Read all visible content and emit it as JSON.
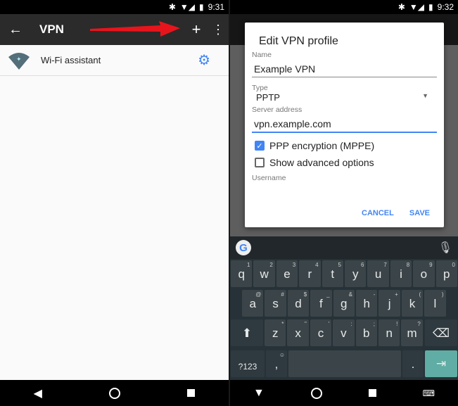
{
  "left": {
    "status_time": "9:31",
    "title": "VPN",
    "add_icon": "+",
    "menu_icon": "⋮",
    "item_label": "Wi-Fi assistant"
  },
  "right": {
    "status_time": "9:32",
    "dialog": {
      "title": "Edit VPN profile",
      "name_label": "Name",
      "name_value": "Example VPN",
      "type_label": "Type",
      "type_value": "PPTP",
      "server_label": "Server address",
      "server_value": "vpn.example.com",
      "ppp_label": "PPP encryption (MPPE)",
      "ppp_checked": true,
      "advanced_label": "Show advanced options",
      "advanced_checked": false,
      "username_label": "Username",
      "cancel": "CANCEL",
      "save": "SAVE"
    },
    "keyboard": {
      "row1": [
        [
          "q",
          "1"
        ],
        [
          "w",
          "2"
        ],
        [
          "e",
          "3"
        ],
        [
          "r",
          "4"
        ],
        [
          "t",
          "5"
        ],
        [
          "y",
          "6"
        ],
        [
          "u",
          "7"
        ],
        [
          "i",
          "8"
        ],
        [
          "o",
          "9"
        ],
        [
          "p",
          "0"
        ]
      ],
      "row2": [
        [
          "a",
          "@"
        ],
        [
          "s",
          "#"
        ],
        [
          "d",
          "$"
        ],
        [
          "f",
          "_"
        ],
        [
          "g",
          "&"
        ],
        [
          "h",
          "-"
        ],
        [
          "j",
          "+"
        ],
        [
          "k",
          "("
        ],
        [
          "l",
          ")"
        ]
      ],
      "row3": [
        [
          "z",
          "*"
        ],
        [
          "x",
          "\""
        ],
        [
          "c",
          "'"
        ],
        [
          "v",
          ":"
        ],
        [
          "b",
          ";"
        ],
        [
          "n",
          "!"
        ],
        [
          "m",
          "?"
        ]
      ],
      "symbols": "?123",
      "comma": ",",
      "period": ".",
      "enter_color": "#5fada4"
    }
  },
  "colors": {
    "accent": "#4285f4",
    "toolbar": "#2b2b2b",
    "arrow": "#e8141c"
  }
}
